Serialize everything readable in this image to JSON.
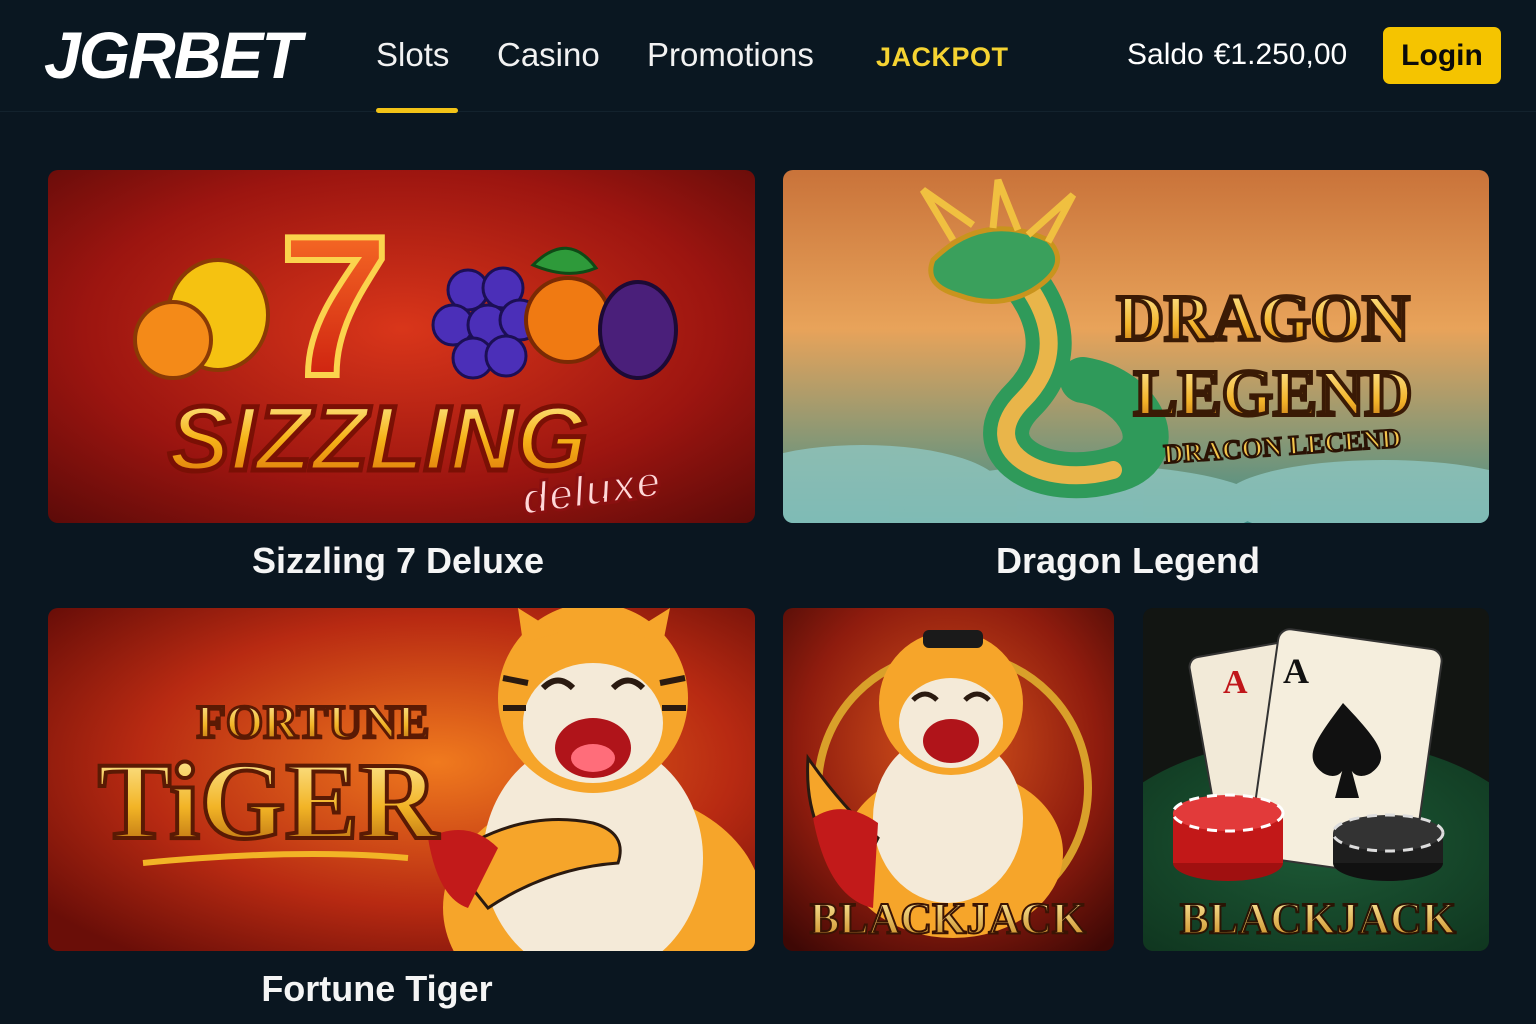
{
  "header": {
    "logo": "JGRBET",
    "nav": [
      {
        "label": "Slots",
        "active": true
      },
      {
        "label": "Casino"
      },
      {
        "label": "Promotions"
      },
      {
        "label": "JACKPOT"
      }
    ],
    "balance_label": "Saldo",
    "balance_value": "€1.250,00",
    "login_label": "Login"
  },
  "games": [
    {
      "title": "Sizzling 7 Deluxe",
      "art_text": "SIZZLING",
      "art_sub": "deluxe",
      "art_number": "7"
    },
    {
      "title": "Dragon Legend",
      "art_line1": "DRAGON",
      "art_line2": "LEGEND",
      "art_sub": "DRACON LECEND"
    },
    {
      "title": "Fortune Tiger",
      "art_line1": "FORTUNE",
      "art_line2": "TiGER"
    },
    {
      "art_text": "BLACKJACK"
    },
    {
      "art_text": "BLACKJACK",
      "card_rank": "A"
    }
  ],
  "colors": {
    "background": "#0a1620",
    "accent": "#f5c400",
    "jackpot": "#f5d332"
  }
}
